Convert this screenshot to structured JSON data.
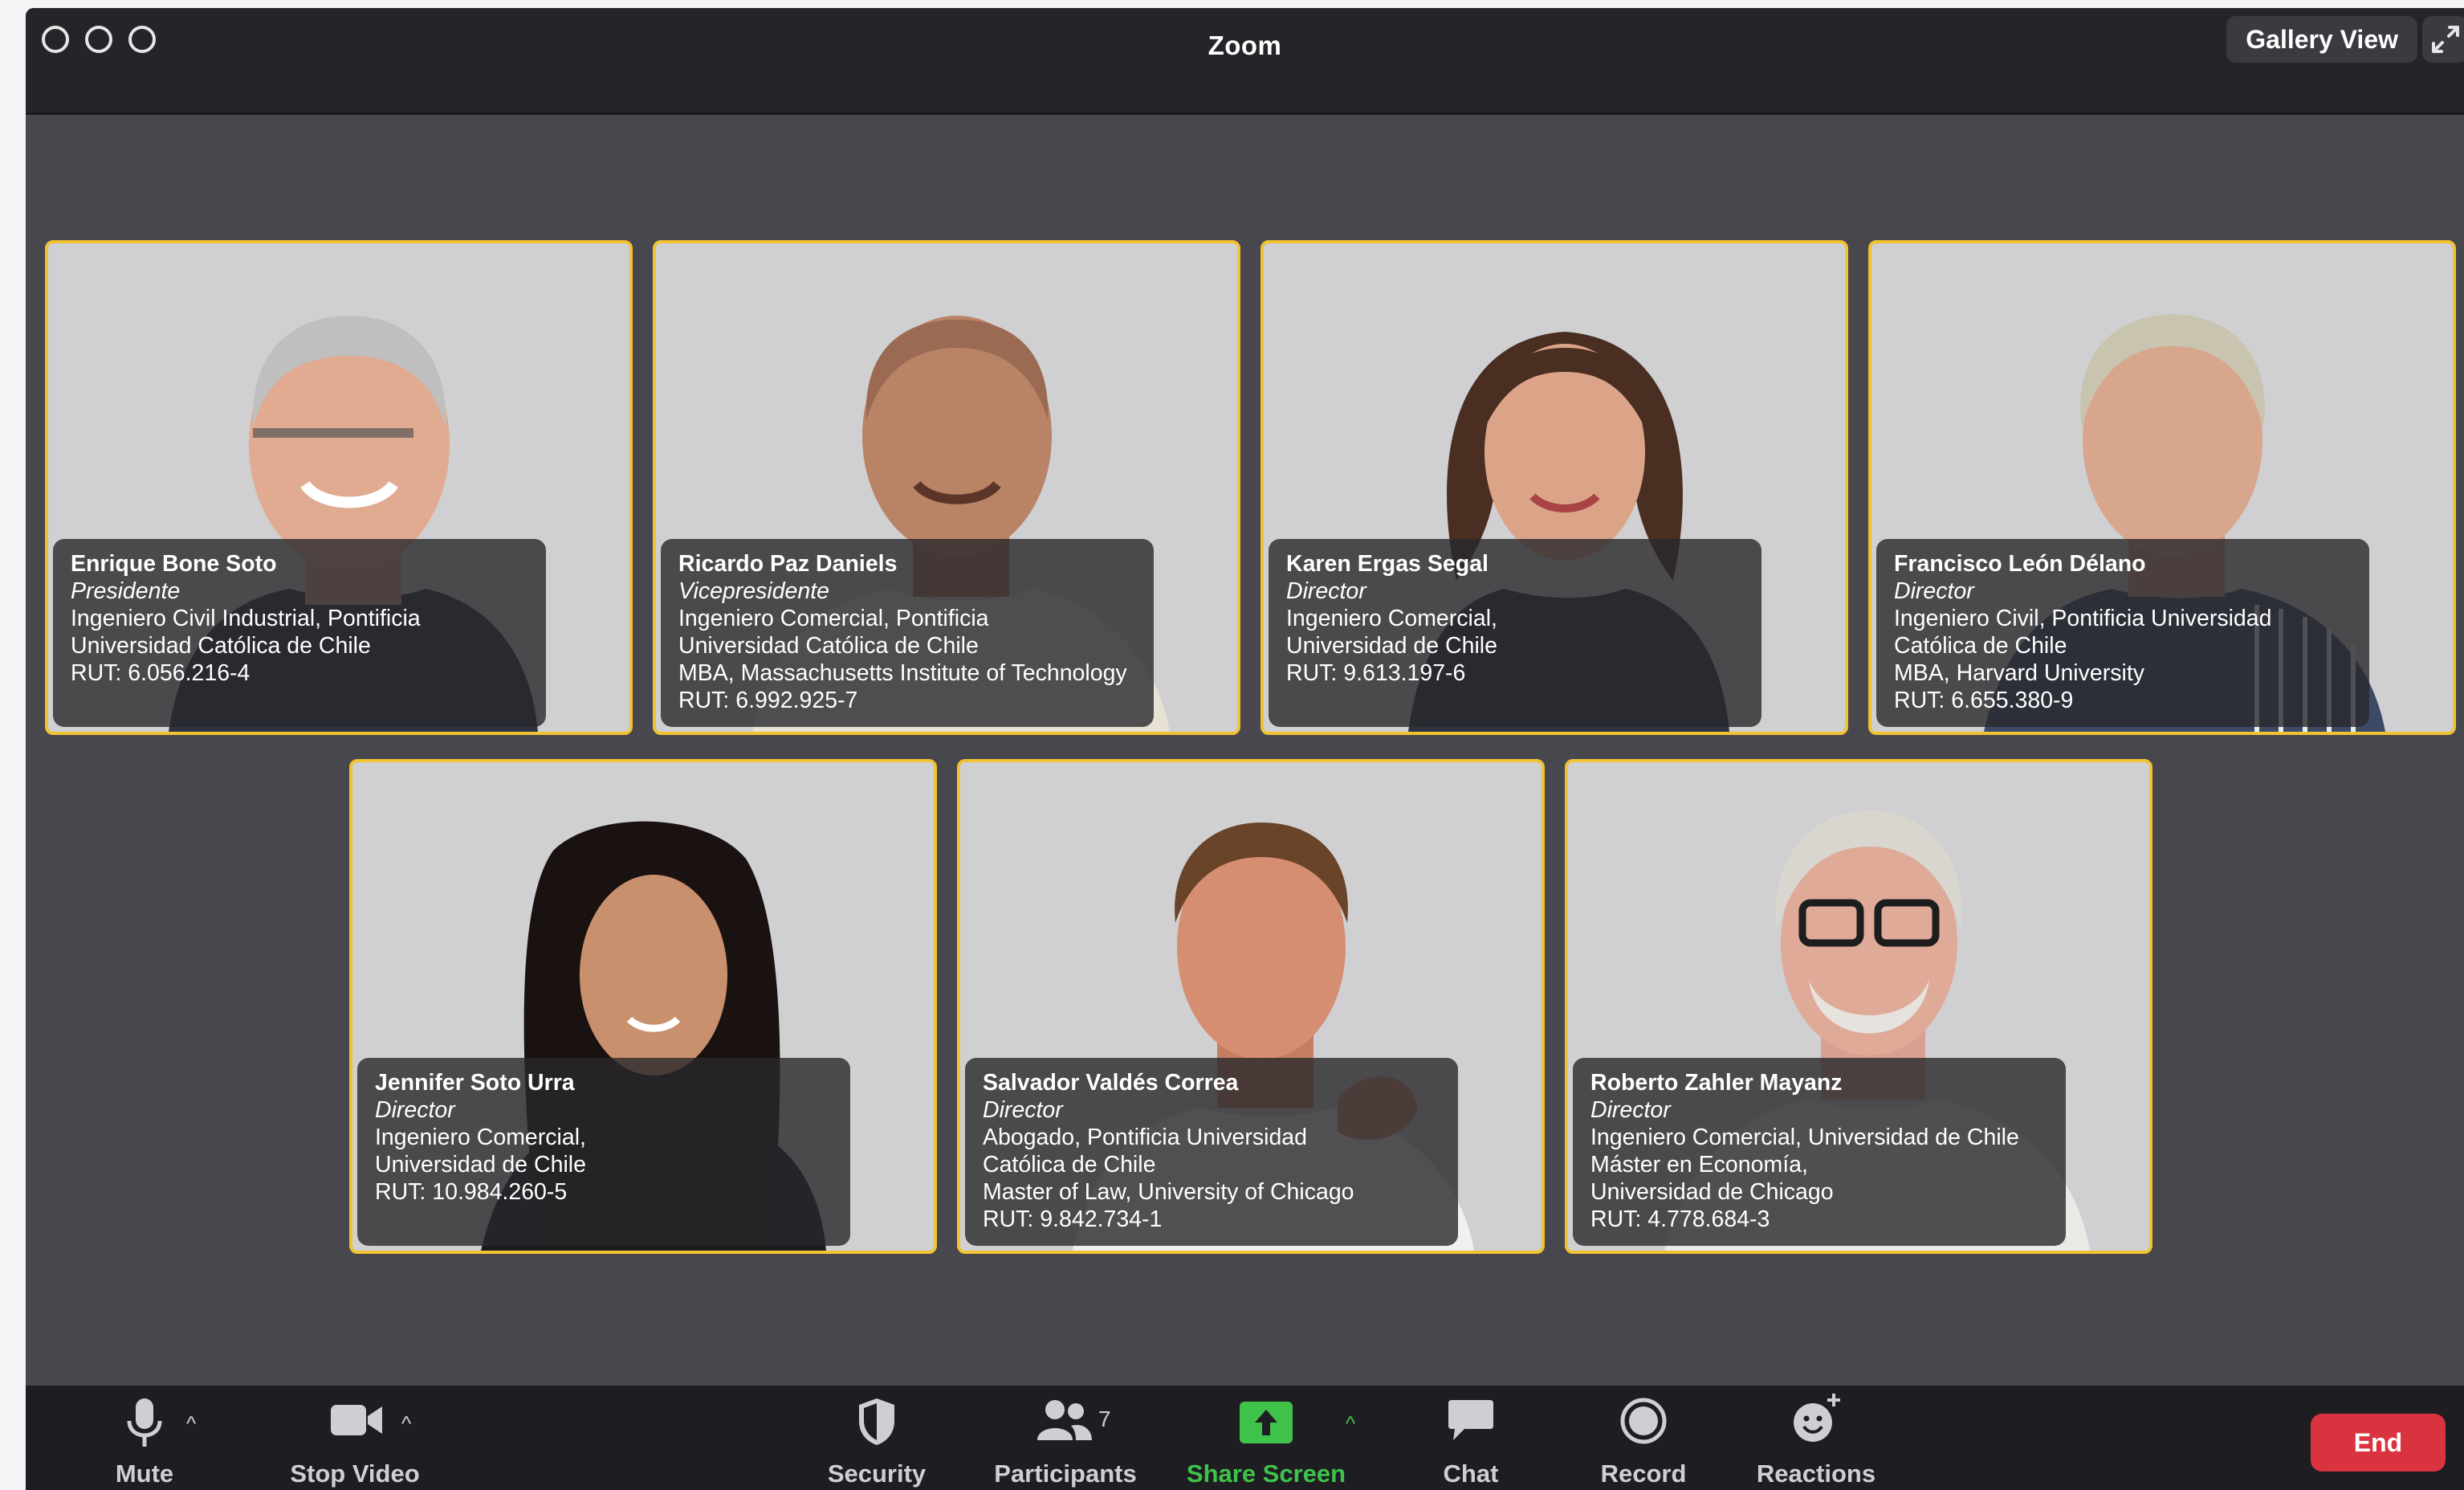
{
  "window": {
    "title": "Zoom",
    "view_label": "Gallery View"
  },
  "participants": [
    {
      "name": "Enrique Bone Soto",
      "role": "Presidente",
      "lines": [
        "Ingeniero Civil Industrial, Pontificia",
        "Universidad Católica de Chile",
        "RUT: 6.056.216-4"
      ]
    },
    {
      "name": "Ricardo Paz Daniels",
      "role": "Vicepresidente",
      "lines": [
        "Ingeniero Comercial, Pontificia",
        "Universidad Católica de Chile",
        "MBA, Massachusetts Institute of Technology",
        "RUT: 6.992.925-7"
      ]
    },
    {
      "name": "Karen Ergas Segal",
      "role": "Director",
      "lines": [
        "Ingeniero Comercial,",
        "Universidad de Chile",
        "RUT: 9.613.197-6"
      ]
    },
    {
      "name": "Francisco León Délano",
      "role": "Director",
      "lines": [
        "Ingeniero Civil, Pontificia Universidad",
        "Católica de Chile",
        "MBA, Harvard University",
        "RUT: 6.655.380-9"
      ]
    },
    {
      "name": "Jennifer Soto Urra",
      "role": "Director",
      "lines": [
        "Ingeniero Comercial,",
        "Universidad de Chile",
        "RUT: 10.984.260-5"
      ]
    },
    {
      "name": "Salvador Valdés Correa",
      "role": "Director",
      "lines": [
        "Abogado, Pontificia Universidad",
        "Católica de Chile",
        "Master of Law, University of Chicago",
        "RUT: 9.842.734-1"
      ]
    },
    {
      "name": "Roberto Zahler Mayanz",
      "role": "Director",
      "lines": [
        "Ingeniero Comercial, Universidad de Chile",
        "Máster en Economía,",
        "Universidad de Chicago",
        "RUT: 4.778.684-3"
      ]
    }
  ],
  "toolbar": {
    "mute": "Mute",
    "stop_video": "Stop Video",
    "security": "Security",
    "participants": "Participants",
    "participants_count": "7",
    "share_screen": "Share Screen",
    "chat": "Chat",
    "record": "Record",
    "reactions": "Reactions",
    "end": "End"
  },
  "colors": {
    "active_speaker_border": "#f1c232",
    "share_screen_green": "#3fc24a",
    "end_red": "#d9333f",
    "toolbar_bg": "#1e1e22",
    "stage_bg": "#47474d"
  },
  "icons": [
    "microphone-icon",
    "video-camera-icon",
    "shield-icon",
    "participants-icon",
    "share-screen-icon",
    "chat-icon",
    "record-icon",
    "reactions-icon",
    "expand-icon"
  ]
}
